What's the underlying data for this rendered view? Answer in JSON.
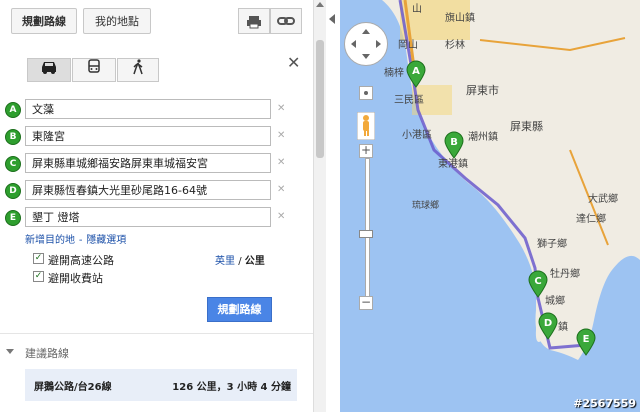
{
  "toolbar": {
    "directions_label": "規劃路線",
    "my_places_label": "我的地點"
  },
  "travel_modes": [
    {
      "name": "driving",
      "icon": "car-icon",
      "active": true
    },
    {
      "name": "transit",
      "icon": "bus-icon",
      "active": false
    },
    {
      "name": "walking",
      "icon": "walk-icon",
      "active": false
    }
  ],
  "stops": [
    {
      "marker": "A",
      "value": "文藻"
    },
    {
      "marker": "B",
      "value": "東隆宮"
    },
    {
      "marker": "C",
      "value": "屏東縣車城鄉福安路屏東車城福安宮"
    },
    {
      "marker": "D",
      "value": "屏東縣恆春鎮大光里砂尾路16-64號"
    },
    {
      "marker": "E",
      "value": "墾丁 燈塔"
    }
  ],
  "links": {
    "add_destination": "新增目的地",
    "separator": "-",
    "hide_options": "隱藏選項"
  },
  "options": {
    "avoid_highways": "避開高速公路",
    "avoid_tolls": "避開收費站",
    "avoid_highways_checked": true,
    "avoid_tolls_checked": true
  },
  "units": {
    "miles": "英里",
    "sep": "/",
    "km": "公里"
  },
  "submit_label": "規劃路線",
  "suggested": {
    "header": "建議路線",
    "route_name": "屏鵝公路/台26線",
    "route_summary": "126 公里，3 小時 4 分鐘"
  },
  "map": {
    "labels": {
      "mountain": "山",
      "qishan": "旗山鎮",
      "gangshan": "岡山",
      "shanlin": "杉林",
      "nanzi": "楠梓",
      "sanmin": "三民區",
      "pingtung_city": "屏東市",
      "xiaogang": "小港區",
      "chaozhou": "潮州鎮",
      "pingtung_county": "屏東縣",
      "donggang": "東港鎮",
      "liuqiu": "琉球鄉",
      "dawu": "大武鄉",
      "daren": "達仁鄉",
      "shizi": "獅子鄉",
      "mudan": "牡丹鄉",
      "checheng": "城鄉",
      "hengchun": "鎮"
    },
    "accent_water": "#9dc3f2",
    "accent_land": "#f0ece3",
    "route_color": "#6a5acd",
    "marker_color": "#3aa83a"
  },
  "watermark": "#2567559"
}
